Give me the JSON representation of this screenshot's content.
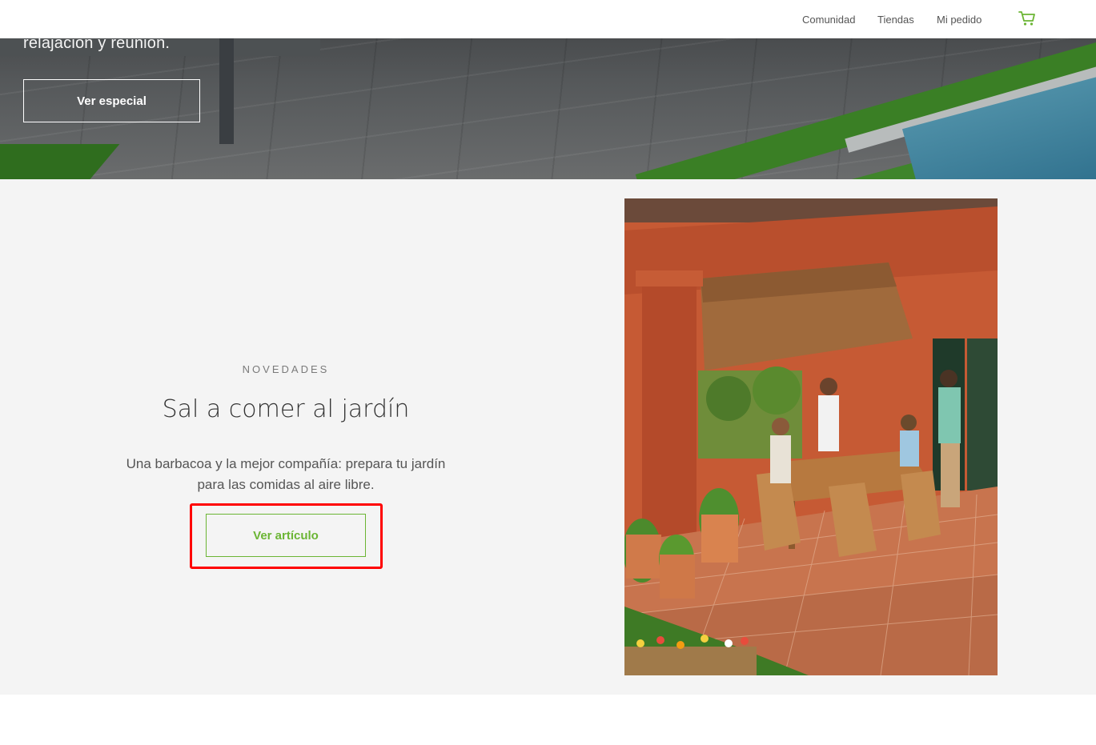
{
  "header": {
    "nav": [
      {
        "label": "Comunidad"
      },
      {
        "label": "Tiendas"
      },
      {
        "label": "Mi pedido"
      }
    ],
    "cart_icon": "cart-icon",
    "accent_color": "#6bb534"
  },
  "hero": {
    "text": "relajación y reunión.",
    "button_label": "Ver especial"
  },
  "feature": {
    "eyebrow": "NOVEDADES",
    "title": "Sal a comer al jardín",
    "description": "Una barbacoa y la mejor compañía: prepara tu jardín para las comidas al aire libre.",
    "button_label": "Ver artículo",
    "highlight_color": "#ff0000"
  }
}
